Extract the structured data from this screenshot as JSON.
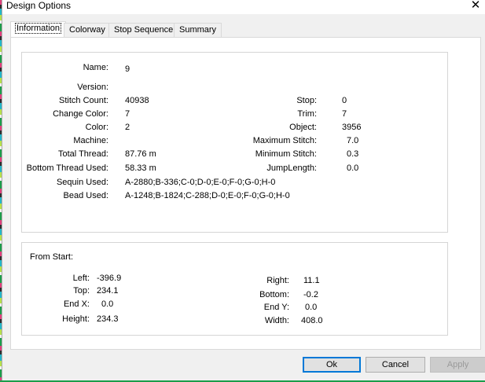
{
  "window": {
    "title": "Design Options",
    "close_glyph": "✕"
  },
  "tabs": [
    {
      "label": "Information"
    },
    {
      "label": "Colorway"
    },
    {
      "label": "Stop Sequence"
    },
    {
      "label": "Summary"
    }
  ],
  "info": {
    "name_label": "Name:",
    "name_value": "9",
    "version_label": "Version:",
    "version_value": "",
    "stitch_count_label": "Stitch Count:",
    "stitch_count_value": "40938",
    "change_color_label": "Change Color:",
    "change_color_value": "7",
    "color_label": "Color:",
    "color_value": "2",
    "machine_label": "Machine:",
    "machine_value": "",
    "total_thread_label": "Total Thread:",
    "total_thread_value": "87.76 m",
    "bottom_thread_label": "Bottom Thread Used:",
    "bottom_thread_value": "58.33 m",
    "sequin_label": "Sequin Used:",
    "sequin_value": "A-2880;B-336;C-0;D-0;E-0;F-0;G-0;H-0",
    "bead_label": "Bead Used:",
    "bead_value": "A-1248;B-1824;C-288;D-0;E-0;F-0;G-0;H-0",
    "stop_label": "Stop:",
    "stop_value": "0",
    "trim_label": "Trim:",
    "trim_value": "7",
    "object_label": "Object:",
    "object_value": "3956",
    "max_stitch_label": "Maximum Stitch:",
    "max_stitch_value": "7.0",
    "min_stitch_label": "Minimum Stitch:",
    "min_stitch_value": "0.3",
    "jump_length_label": "JumpLength:",
    "jump_length_value": "0.0"
  },
  "from_start": {
    "heading": "From Start:",
    "left_label": "Left:",
    "left_value": "-396.9",
    "top_label": "Top:",
    "top_value": "234.1",
    "endx_label": "End X:",
    "endx_value": "0.0",
    "height_label": "Height:",
    "height_value": "234.3",
    "right_label": "Right:",
    "right_value": "11.1",
    "bottom_label": "Bottom:",
    "bottom_value": "-0.2",
    "endy_label": "End Y:",
    "endy_value": "0.0",
    "width_label": "Width:",
    "width_value": "408.0"
  },
  "buttons": {
    "ok": "Ok",
    "cancel": "Cancel",
    "apply": "Apply"
  },
  "colors": {
    "focus_border": "#0078d7",
    "dialog_bg": "#f0f0f0"
  }
}
